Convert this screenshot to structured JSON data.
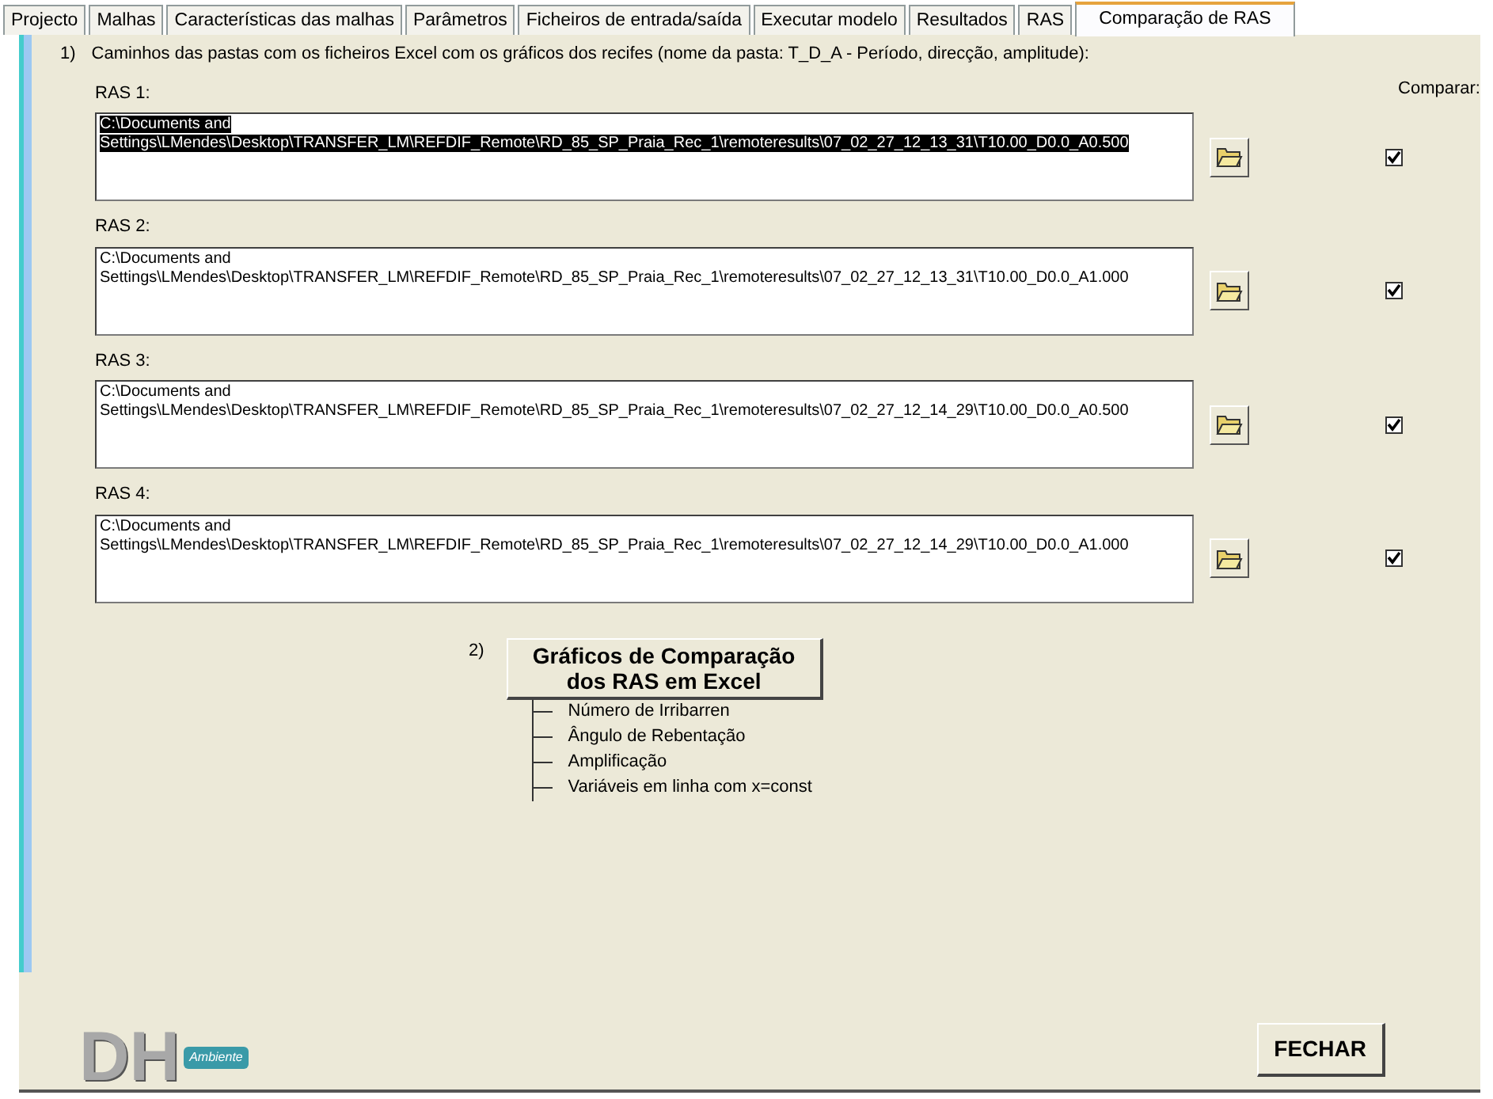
{
  "tabs": [
    {
      "label": "Projecto",
      "selected": false
    },
    {
      "label": "Malhas",
      "selected": false
    },
    {
      "label": "Características das malhas",
      "selected": false
    },
    {
      "label": "Parâmetros",
      "selected": false
    },
    {
      "label": "Ficheiros de entrada/saída",
      "selected": false
    },
    {
      "label": "Executar modelo",
      "selected": false
    },
    {
      "label": "Resultados",
      "selected": false
    },
    {
      "label": "RAS",
      "selected": false
    },
    {
      "label": "Comparação de RAS",
      "selected": true
    }
  ],
  "step1": {
    "number": "1)",
    "text": "Caminhos das pastas com os ficheiros Excel com os gráficos  dos recifes (nome da pasta: T_D_A - Período, direcção, amplitude):"
  },
  "compare_header": "Comparar:",
  "ras": [
    {
      "label": "RAS 1:",
      "path": "C:\\Documents and Settings\\LMendes\\Desktop\\TRANSFER_LM\\REFDIF_Remote\\RD_85_SP_Praia_Rec_1\\remoteresults\\07_02_27_12_13_31\\T10.00_D0.0_A0.500",
      "text_selected": true,
      "checked": true
    },
    {
      "label": "RAS 2:",
      "path": "C:\\Documents and Settings\\LMendes\\Desktop\\TRANSFER_LM\\REFDIF_Remote\\RD_85_SP_Praia_Rec_1\\remoteresults\\07_02_27_12_13_31\\T10.00_D0.0_A1.000",
      "text_selected": false,
      "checked": true
    },
    {
      "label": "RAS 3:",
      "path": "C:\\Documents and Settings\\LMendes\\Desktop\\TRANSFER_LM\\REFDIF_Remote\\RD_85_SP_Praia_Rec_1\\remoteresults\\07_02_27_12_14_29\\T10.00_D0.0_A0.500",
      "text_selected": false,
      "checked": true
    },
    {
      "label": "RAS 4:",
      "path": "C:\\Documents and Settings\\LMendes\\Desktop\\TRANSFER_LM\\REFDIF_Remote\\RD_85_SP_Praia_Rec_1\\remoteresults\\07_02_27_12_14_29\\T10.00_D0.0_A1.000",
      "text_selected": false,
      "checked": true
    }
  ],
  "step2": {
    "number": "2)",
    "button": "Gráficos de Comparação dos RAS em Excel",
    "options": [
      "Número de Irribarren",
      "Ângulo de Rebentação",
      "Amplificação",
      "Variáveis em linha com x=const"
    ]
  },
  "logo": {
    "letters": "DH",
    "ribbon": "Ambiente"
  },
  "close_button": "FECHAR"
}
